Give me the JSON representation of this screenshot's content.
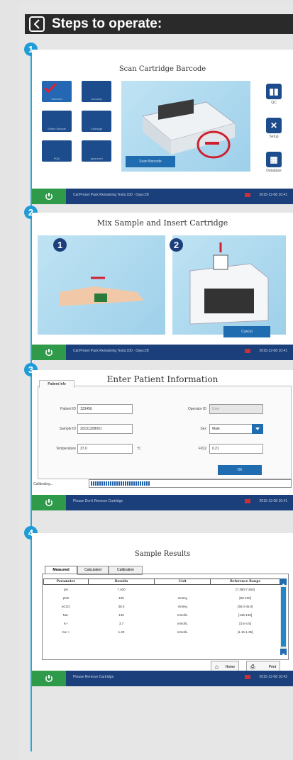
{
  "header": {
    "title": "Steps to operate:"
  },
  "steps": {
    "s1": {
      "number": "1",
      "title": "Scan Cartridge Barcode",
      "tiles": [
        "Selected",
        "Unready",
        "Select Sample",
        "Cartridge",
        "PQA",
        "Approved"
      ],
      "side_buttons": [
        {
          "label": "QC",
          "glyph": "▮▮"
        },
        {
          "label": "Setup",
          "glyph": "✕"
        },
        {
          "label": "Database",
          "glyph": "▦"
        }
      ],
      "scan_button": "Scan Barcode",
      "status": {
        "text": "Cal:Preset Pack Remaining Tests:100 · Days:28",
        "time": "2015-12-08  10:41"
      }
    },
    "s2": {
      "number": "2",
      "title": "Mix Sample and Insert Cartridge",
      "markers": [
        "1",
        "2"
      ],
      "cancel_button": "Cancel",
      "status": {
        "text": "Cal:Preset Pack Remaining Tests:100 · Days:28",
        "time": "2015-12-08  10:41"
      }
    },
    "s3": {
      "number": "3",
      "title": "Enter Patient Information",
      "tab": "Patient Info",
      "fields": {
        "patient_id": {
          "label": "Patient ID",
          "value": "123456"
        },
        "operator_id": {
          "label": "Operator ID",
          "value": "User"
        },
        "sample_id": {
          "label": "Sample ID",
          "value": "20151208001"
        },
        "sex": {
          "label": "Sex",
          "value": "Male"
        },
        "temperature": {
          "label": "Temperature",
          "value": "37.0",
          "unit": "℃"
        },
        "fio2": {
          "label": "FIO2",
          "value": "0.21"
        }
      },
      "ok_button": "OK",
      "calibrating": "Calibrating...",
      "progress": 0.3,
      "status": {
        "text": "Please Don't Remove Cartridge",
        "time": "2015-12-08  10:41"
      }
    },
    "s4": {
      "number": "4",
      "title": "Sample Results",
      "tabs": [
        "Measured",
        "Calculated",
        "Calibration"
      ],
      "columns": [
        "Parameter",
        "Results",
        "Unit",
        "Reference Range"
      ],
      "rows": [
        [
          "pH",
          "7.400",
          "",
          "[7.350-7.450]"
        ],
        [
          "pO2",
          "100",
          "mmHg",
          "[80-100]"
        ],
        [
          "pCO2",
          "38.0",
          "mmHg",
          "[35.0-45.0]"
        ],
        [
          "Na+",
          "140",
          "mmol/L",
          "[136-146]"
        ],
        [
          "K+",
          "3.7",
          "mmol/L",
          "[3.5-4.5]"
        ],
        [
          "Ca++",
          "1.20",
          "mmol/L",
          "[1.15-1.35]"
        ]
      ],
      "home_button": "Home",
      "print_button": "Print",
      "status": {
        "text": "Please Remove Cartridge",
        "time": "2015-12-08  10:42"
      }
    }
  },
  "colors": {
    "accent": "#1f9bd7",
    "status_bar": "#1b3f7a",
    "power": "#2e9a4a",
    "tile": "#1c4c8c"
  }
}
